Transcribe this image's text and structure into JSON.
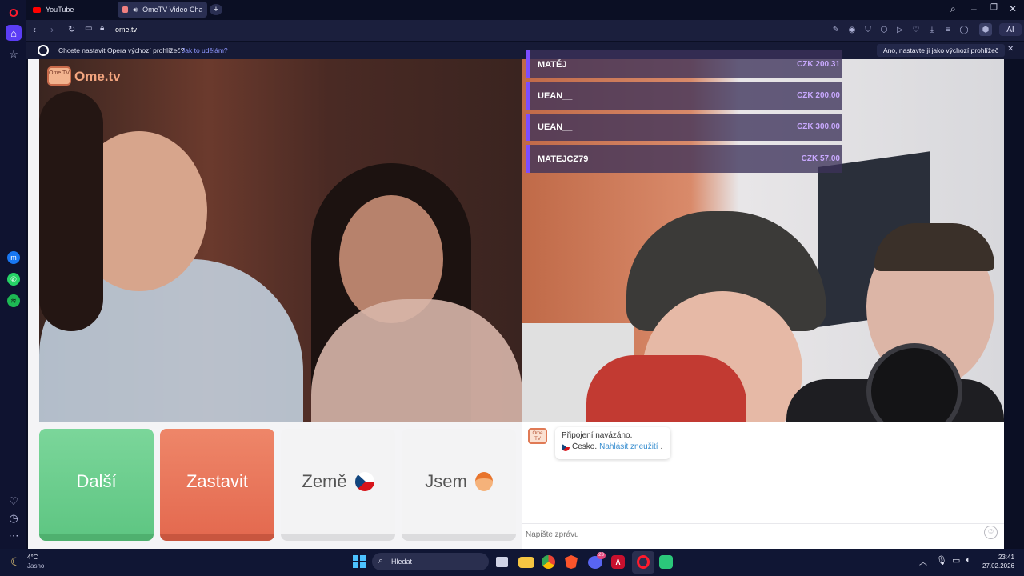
{
  "tabs": [
    {
      "label": "YouTube"
    },
    {
      "label": "OmeTV Video Chat -..."
    }
  ],
  "address": {
    "url": "ome.tv"
  },
  "infobar": {
    "question": "Chcete nastavit Opera výchozí prohlížeč?",
    "link": "Jak to udělám?",
    "confirm": "Ano, nastavte ji jako výchozí prohlížeč"
  },
  "site": {
    "logo": "Ome.tv",
    "logo_badge": "Ome TV"
  },
  "donations": [
    {
      "name": "MATĚJ",
      "amount": "CZK 200.31"
    },
    {
      "name": "UEAN__",
      "amount": "CZK 200.00"
    },
    {
      "name": "UEAN__",
      "amount": "CZK 300.00"
    },
    {
      "name": "MATEJCZ79",
      "amount": "CZK 57.00"
    }
  ],
  "controls": {
    "next": "Další",
    "stop": "Zastavit",
    "country": "Země",
    "gender": "Jsem"
  },
  "chat": {
    "status": "Připojení navázáno.",
    "country": "Česko.",
    "report": "Nahlásit zneužití",
    "placeholder": "Napište zprávu"
  },
  "taskbar": {
    "weather_temp": "4°C",
    "weather_desc": "Jasno",
    "search": "Hledat",
    "time": "23:41",
    "date": "27.02.2026",
    "discord_badge": "23"
  },
  "colors": {
    "next_button": "#6fcf8f",
    "stop_button": "#e9785f",
    "accent": "#7c4dff"
  }
}
